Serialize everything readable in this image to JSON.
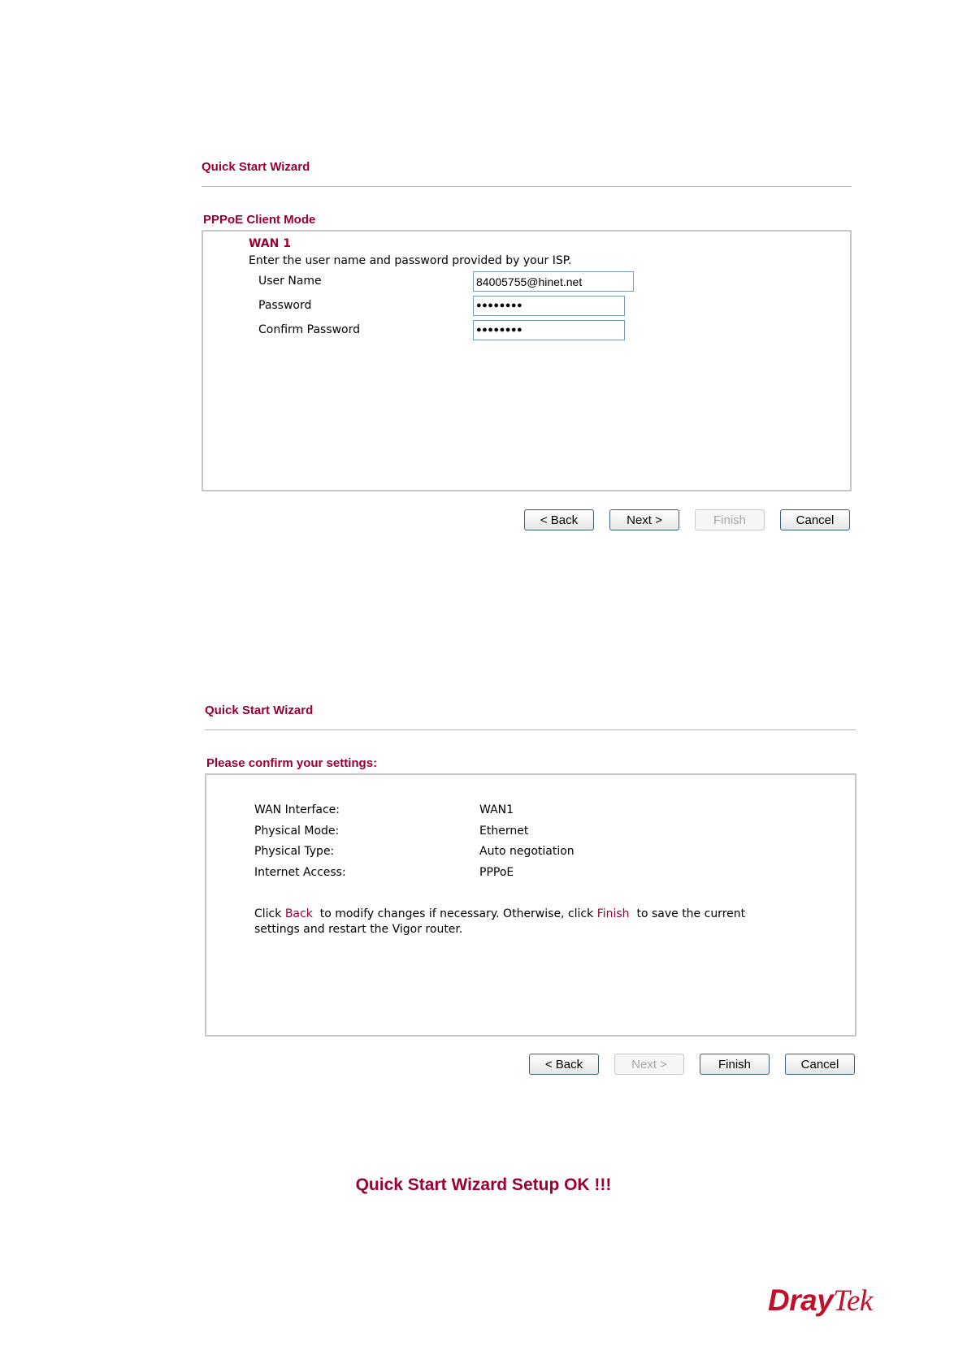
{
  "wizard1": {
    "title": "Quick Start Wizard",
    "section_title": "PPPoE Client Mode",
    "wan_label": "WAN 1",
    "instruction": "Enter the user name and password provided by your ISP.",
    "fields": {
      "username_label": "User Name",
      "username_value": "84005755@hinet.net",
      "password_label": "Password",
      "password_value": "●●●●●●●●",
      "confirm_label": "Confirm Password",
      "confirm_value": "●●●●●●●●"
    },
    "buttons": {
      "back": "< Back",
      "next": "Next >",
      "finish": "Finish",
      "cancel": "Cancel"
    }
  },
  "wizard2": {
    "title": "Quick Start Wizard",
    "section_title": "Please confirm your settings:",
    "settings": [
      {
        "label": "WAN Interface:",
        "value": "WAN1"
      },
      {
        "label": "Physical Mode:",
        "value": "Ethernet"
      },
      {
        "label": "Physical Type:",
        "value": "Auto negotiation"
      },
      {
        "label": "Internet Access:",
        "value": "PPPoE"
      }
    ],
    "note": {
      "part1": "Click ",
      "back_word": "Back",
      "part2": "  to modify changes if necessary. Otherwise, click ",
      "finish_word": "Finish",
      "part3": "  to save the current",
      "line2": "settings and restart the Vigor router."
    },
    "buttons": {
      "back": "< Back",
      "next": "Next >",
      "finish": "Finish",
      "cancel": "Cancel"
    }
  },
  "setup_ok": "Quick Start Wizard Setup OK !!!",
  "logo": {
    "part1": "Dray",
    "part2": "Tek",
    "color": "#c0102a"
  },
  "colors": {
    "accent": "#990033",
    "panel_border": "#c8c8c8"
  }
}
